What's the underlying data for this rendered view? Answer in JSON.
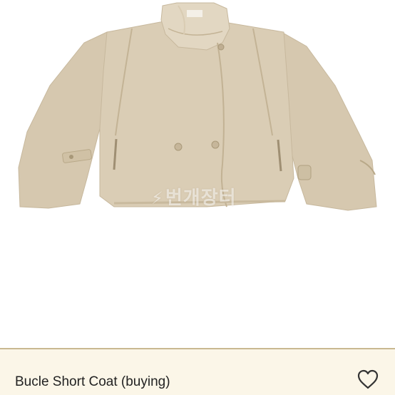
{
  "product": {
    "title": "Bucle Short Coat (buying)",
    "watermark_text": "번개장터",
    "image_alt": "beige bouclé short coat with funnel collar",
    "coat_color": "#d8cbb3"
  },
  "actions": {
    "favorite_icon": "heart-outline-icon"
  },
  "colors": {
    "footer_bg": "#fbf6e8",
    "divider": "#c9b890",
    "text": "#222222"
  }
}
